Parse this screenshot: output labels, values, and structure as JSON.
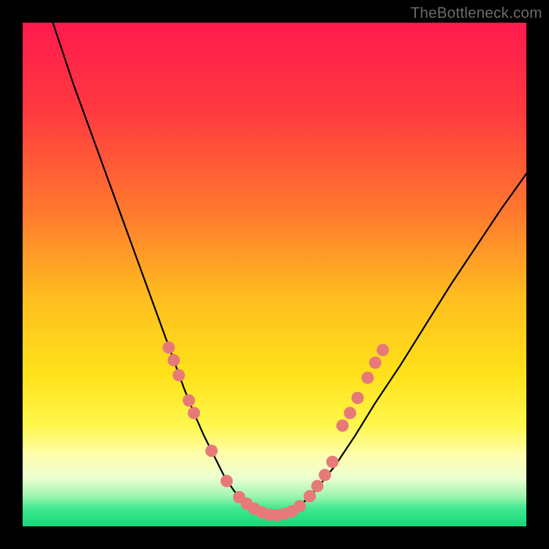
{
  "watermark": "TheBottleneck.com",
  "chart_data": {
    "type": "line",
    "title": "",
    "xlabel": "",
    "ylabel": "",
    "xlim": [
      0,
      100
    ],
    "ylim": [
      0,
      100
    ],
    "grid": false,
    "legend": false,
    "background_gradient_stops": [
      {
        "offset": 0.0,
        "color": "#ff1a4d"
      },
      {
        "offset": 0.18,
        "color": "#ff3b3f"
      },
      {
        "offset": 0.38,
        "color": "#ff7a2e"
      },
      {
        "offset": 0.55,
        "color": "#ffbf1f"
      },
      {
        "offset": 0.7,
        "color": "#ffe21a"
      },
      {
        "offset": 0.8,
        "color": "#fff74d"
      },
      {
        "offset": 0.86,
        "color": "#fffeb0"
      },
      {
        "offset": 0.905,
        "color": "#eaffd0"
      },
      {
        "offset": 0.94,
        "color": "#9ff5b0"
      },
      {
        "offset": 0.965,
        "color": "#3fe88e"
      },
      {
        "offset": 1.0,
        "color": "#17d87a"
      }
    ],
    "series": [
      {
        "name": "bottleneck-curve",
        "color": "#000000",
        "x": [
          6,
          8,
          10,
          12,
          14,
          16,
          18,
          20,
          22,
          24,
          26,
          28,
          30,
          32,
          34,
          36,
          38,
          40,
          42,
          44,
          46,
          48,
          50,
          52,
          55,
          58,
          62,
          66,
          70,
          75,
          80,
          85,
          90,
          95,
          100
        ],
        "y": [
          100,
          94,
          88,
          82.5,
          77,
          71.5,
          66,
          60.5,
          55,
          49.5,
          44,
          38.5,
          33,
          27.5,
          22.5,
          18,
          14,
          10,
          7,
          5,
          3.5,
          2.5,
          2.2,
          2.5,
          4,
          7,
          12,
          18,
          24.5,
          32,
          40,
          48,
          55.5,
          63,
          70
        ]
      }
    ],
    "markers": {
      "name": "highlight-dots",
      "color": "#e77a78",
      "radius_px": 9,
      "points": [
        {
          "x": 29.0,
          "y": 35.5
        },
        {
          "x": 30.0,
          "y": 33.0
        },
        {
          "x": 31.0,
          "y": 30.0
        },
        {
          "x": 33.0,
          "y": 25.0
        },
        {
          "x": 34.0,
          "y": 22.5
        },
        {
          "x": 37.5,
          "y": 15.0
        },
        {
          "x": 40.5,
          "y": 9.0
        },
        {
          "x": 43.0,
          "y": 5.8
        },
        {
          "x": 44.5,
          "y": 4.5
        },
        {
          "x": 46.0,
          "y": 3.5
        },
        {
          "x": 47.5,
          "y": 2.8
        },
        {
          "x": 49.0,
          "y": 2.3
        },
        {
          "x": 50.5,
          "y": 2.2
        },
        {
          "x": 52.0,
          "y": 2.5
        },
        {
          "x": 53.5,
          "y": 3.0
        },
        {
          "x": 55.0,
          "y": 4.0
        },
        {
          "x": 57.0,
          "y": 6.0
        },
        {
          "x": 58.5,
          "y": 8.0
        },
        {
          "x": 60.0,
          "y": 10.2
        },
        {
          "x": 61.5,
          "y": 12.8
        },
        {
          "x": 63.5,
          "y": 20.0
        },
        {
          "x": 65.0,
          "y": 22.5
        },
        {
          "x": 66.5,
          "y": 25.5
        },
        {
          "x": 68.5,
          "y": 29.5
        },
        {
          "x": 70.0,
          "y": 32.5
        },
        {
          "x": 71.5,
          "y": 35.0
        }
      ]
    }
  }
}
